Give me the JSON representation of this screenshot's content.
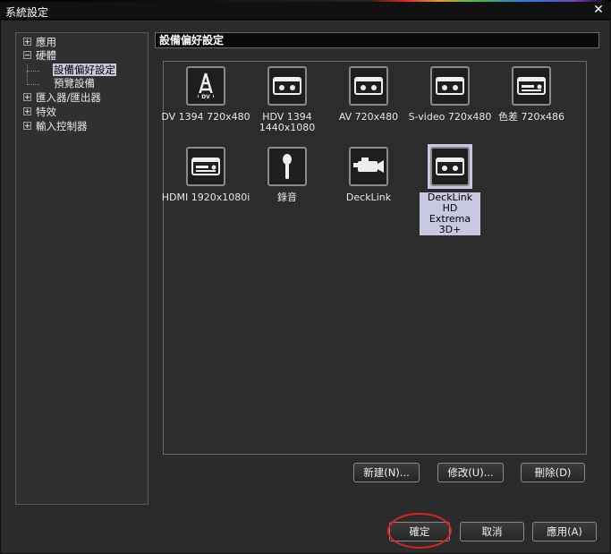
{
  "window": {
    "title": "系統設定",
    "close_glyph": "✕"
  },
  "tree": {
    "items": [
      {
        "label": "應用",
        "expander": "plus"
      },
      {
        "label": "硬體",
        "expander": "minus"
      },
      {
        "label": "設備偏好設定",
        "child": true,
        "selected": true
      },
      {
        "label": "預覽設備",
        "child": true
      },
      {
        "label": "匯入器/匯出器",
        "expander": "plus"
      },
      {
        "label": "特效",
        "expander": "plus"
      },
      {
        "label": "輸入控制器",
        "expander": "plus"
      }
    ]
  },
  "panel": {
    "title": "設備偏好設定"
  },
  "devices": [
    {
      "label": "DV 1394 720x480",
      "icon": "dv-icon"
    },
    {
      "label": "HDV 1394 1440x1080",
      "icon": "tape-icon"
    },
    {
      "label": "AV 720x480",
      "icon": "tape-icon"
    },
    {
      "label": "S-video 720x480",
      "icon": "tape-icon"
    },
    {
      "label": "色差 720x486",
      "icon": "deck-icon"
    },
    {
      "label": "HDMI 1920x1080i",
      "icon": "deck-icon"
    },
    {
      "label": "錄音",
      "icon": "microphone-icon"
    },
    {
      "label": "DeckLink",
      "icon": "camera-icon"
    },
    {
      "label": "DeckLink HD Extrema 3D+",
      "icon": "tape-icon",
      "selected": true
    }
  ],
  "buttons": {
    "new": "新建(N)...",
    "modify": "修改(U)...",
    "delete": "刪除(D)",
    "ok": "確定",
    "cancel": "取消",
    "apply": "應用(A)"
  },
  "colors": {
    "selection": "#c8c8e0",
    "highlight_ring": "#dd2222"
  }
}
